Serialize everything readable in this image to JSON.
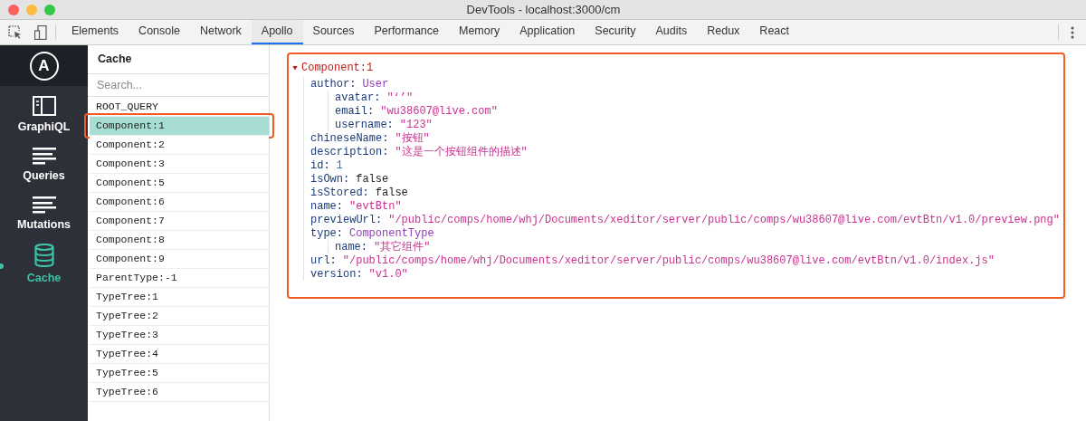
{
  "window": {
    "title": "DevTools - localhost:3000/cm"
  },
  "toolbar_tabs": [
    {
      "label": "Elements",
      "selected": false
    },
    {
      "label": "Console",
      "selected": false
    },
    {
      "label": "Network",
      "selected": false
    },
    {
      "label": "Apollo",
      "selected": true
    },
    {
      "label": "Sources",
      "selected": false
    },
    {
      "label": "Performance",
      "selected": false
    },
    {
      "label": "Memory",
      "selected": false
    },
    {
      "label": "Application",
      "selected": false
    },
    {
      "label": "Security",
      "selected": false
    },
    {
      "label": "Audits",
      "selected": false
    },
    {
      "label": "Redux",
      "selected": false
    },
    {
      "label": "React",
      "selected": false
    }
  ],
  "sidebar": {
    "logo": "A",
    "items": [
      {
        "label": "GraphiQL",
        "kind": "graphiql",
        "selected": false
      },
      {
        "label": "Queries",
        "kind": "queries",
        "selected": false
      },
      {
        "label": "Mutations",
        "kind": "mutations",
        "selected": false
      },
      {
        "label": "Cache",
        "kind": "cache",
        "selected": true
      }
    ]
  },
  "cache": {
    "title": "Cache",
    "search": {
      "placeholder": "Search..."
    },
    "items": [
      {
        "label": "ROOT_QUERY",
        "selected": false
      },
      {
        "label": "Component:1",
        "selected": true
      },
      {
        "label": "Component:2",
        "selected": false
      },
      {
        "label": "Component:3",
        "selected": false
      },
      {
        "label": "Component:5",
        "selected": false
      },
      {
        "label": "Component:6",
        "selected": false
      },
      {
        "label": "Component:7",
        "selected": false
      },
      {
        "label": "Component:8",
        "selected": false
      },
      {
        "label": "Component:9",
        "selected": false
      },
      {
        "label": "ParentType:-1",
        "selected": false
      },
      {
        "label": "TypeTree:1",
        "selected": false
      },
      {
        "label": "TypeTree:2",
        "selected": false
      },
      {
        "label": "TypeTree:3",
        "selected": false
      },
      {
        "label": "TypeTree:4",
        "selected": false
      },
      {
        "label": "TypeTree:5",
        "selected": false
      },
      {
        "label": "TypeTree:6",
        "selected": false
      }
    ]
  },
  "detail": {
    "key": "Component:1",
    "expanded": true,
    "children": [
      {
        "key": "author:",
        "value": "User",
        "kind": "type",
        "children": [
          {
            "key": "avatar:",
            "value": "\"‘’\"",
            "kind": "string"
          },
          {
            "key": "email:",
            "value": "\"wu38607@live.com\"",
            "kind": "string"
          },
          {
            "key": "username:",
            "value": "\"123\"",
            "kind": "string"
          }
        ]
      },
      {
        "key": "chineseName:",
        "value": "\"按钮\"",
        "kind": "string"
      },
      {
        "key": "description:",
        "value": "\"这是一个按钮组件的描述\"",
        "kind": "string"
      },
      {
        "key": "id:",
        "value": "1",
        "kind": "number"
      },
      {
        "key": "isOwn:",
        "value": "false",
        "kind": "boolean"
      },
      {
        "key": "isStored:",
        "value": "false",
        "kind": "boolean"
      },
      {
        "key": "name:",
        "value": "\"evtBtn\"",
        "kind": "string"
      },
      {
        "key": "previewUrl:",
        "value": "\"/public/comps/home/whj/Documents/xeditor/server/public/comps/wu38607@live.com/evtBtn/v1.0/preview.png\"",
        "kind": "string"
      },
      {
        "key": "type:",
        "value": "ComponentType",
        "kind": "type",
        "children": [
          {
            "key": "name:",
            "value": "\"其它组件\"",
            "kind": "string"
          }
        ]
      },
      {
        "key": "url:",
        "value": "\"/public/comps/home/whj/Documents/xeditor/server/public/comps/wu38607@live.com/evtBtn/v1.0/index.js\"",
        "kind": "string"
      },
      {
        "key": "version:",
        "value": "\"v1.0\"",
        "kind": "string"
      }
    ]
  }
}
